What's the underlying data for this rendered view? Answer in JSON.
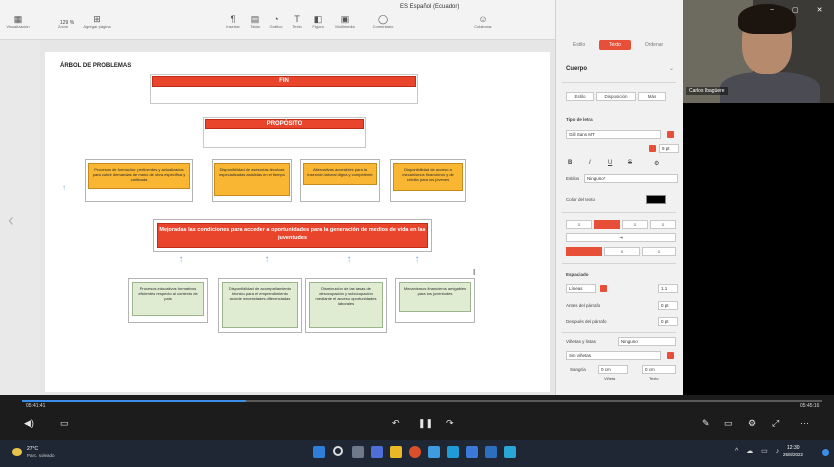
{
  "app": {
    "document_title": "ES Español (Ecuador)",
    "zoom": "129 %"
  },
  "ribbon": {
    "items": [
      {
        "label": "Visualización",
        "icon": "view-icon"
      },
      {
        "label": "Zoom",
        "icon": "zoom-icon"
      },
      {
        "label": "Agregar página",
        "icon": "add-page-icon"
      },
      {
        "label": "Insertar",
        "icon": "insert-icon"
      },
      {
        "label": "Tabla",
        "icon": "table-icon"
      },
      {
        "label": "Gráfico",
        "icon": "chart-icon"
      },
      {
        "label": "Texto",
        "icon": "text-icon"
      },
      {
        "label": "Figura",
        "icon": "shape-icon"
      },
      {
        "label": "Multimedia",
        "icon": "media-icon"
      },
      {
        "label": "Comentario",
        "icon": "comment-icon"
      },
      {
        "label": "Colaborar",
        "icon": "collaborate-icon"
      },
      {
        "label": "Formato",
        "icon": "format-icon"
      },
      {
        "label": "Documento",
        "icon": "document-icon"
      }
    ]
  },
  "slide": {
    "title": "ÁRBOL DE PROBLEMAS",
    "fin": "FIN",
    "proposito": "PROPÓSITO",
    "orange_boxes": [
      "Procesos de formación: pertinentes y actualizados para cubrir demandas de mano de obra específica y calificada",
      "Disponibilidad de asesorías técnicas especializadas asistidas en el tiempo",
      "Alternativas accesibles para la inserción laboral digna y competente",
      "Disponibilidad de acceso a mecanismos financieros y de crédito para los jóvenes"
    ],
    "central": "Mejoradas las condiciones para acceder a oportunidades para la generación de medios de vida en las juventudes",
    "green_boxes": [
      "Procesos educativos formativos eficientes respecto al contexto de país",
      "Disponibilidad de acompañamiento técnico para el emprendimiento acorde necesidades diferenciadas",
      "Disminución de las tasas de desocupación y subocupación mediante el acceso oportunidades laborales",
      "Mecanismos financieros amigables para los juventudes"
    ]
  },
  "panel": {
    "tabs": [
      "Estilo",
      "Texto",
      "Ordenar"
    ],
    "style_value": "Cuerpo",
    "subtabs": [
      "Estilo",
      "Disposición",
      "Más"
    ],
    "font_section": "Tipo de letra",
    "font_name": "Gill Sans MT",
    "font_size": "9 pt",
    "char_styles_label": "Estilos",
    "char_styles_value": "Ninguno*",
    "text_color_label": "Color del texto",
    "spacing_label": "Espaciado",
    "spacing_mode": "Líneas",
    "spacing_value": "1.1",
    "before_label": "Antes del párrafo",
    "before_value": "0 pt",
    "after_label": "Después del párrafo",
    "after_value": "0 pt",
    "bullets_label": "Viñetas y listas",
    "bullets_value": "Ninguno",
    "no_bullets": "Sin viñetas",
    "indent_label": "Sangría",
    "indent_bullet": "0 cm",
    "indent_text": "0 cm",
    "indent_sub1": "Viñeta",
    "indent_sub2": "Texto",
    "capitals_label": "Capitular",
    "accent_color": "#e84f38"
  },
  "video": {
    "participant_name": "Carlos Ibagüere"
  },
  "player": {
    "time_current": "05:41:41",
    "time_total": "05:45:16",
    "progress": 0.28
  },
  "taskbar": {
    "temperature": "27°C",
    "weather": "Parc. soleado",
    "time": "12:30",
    "date": "25/8/2022"
  }
}
